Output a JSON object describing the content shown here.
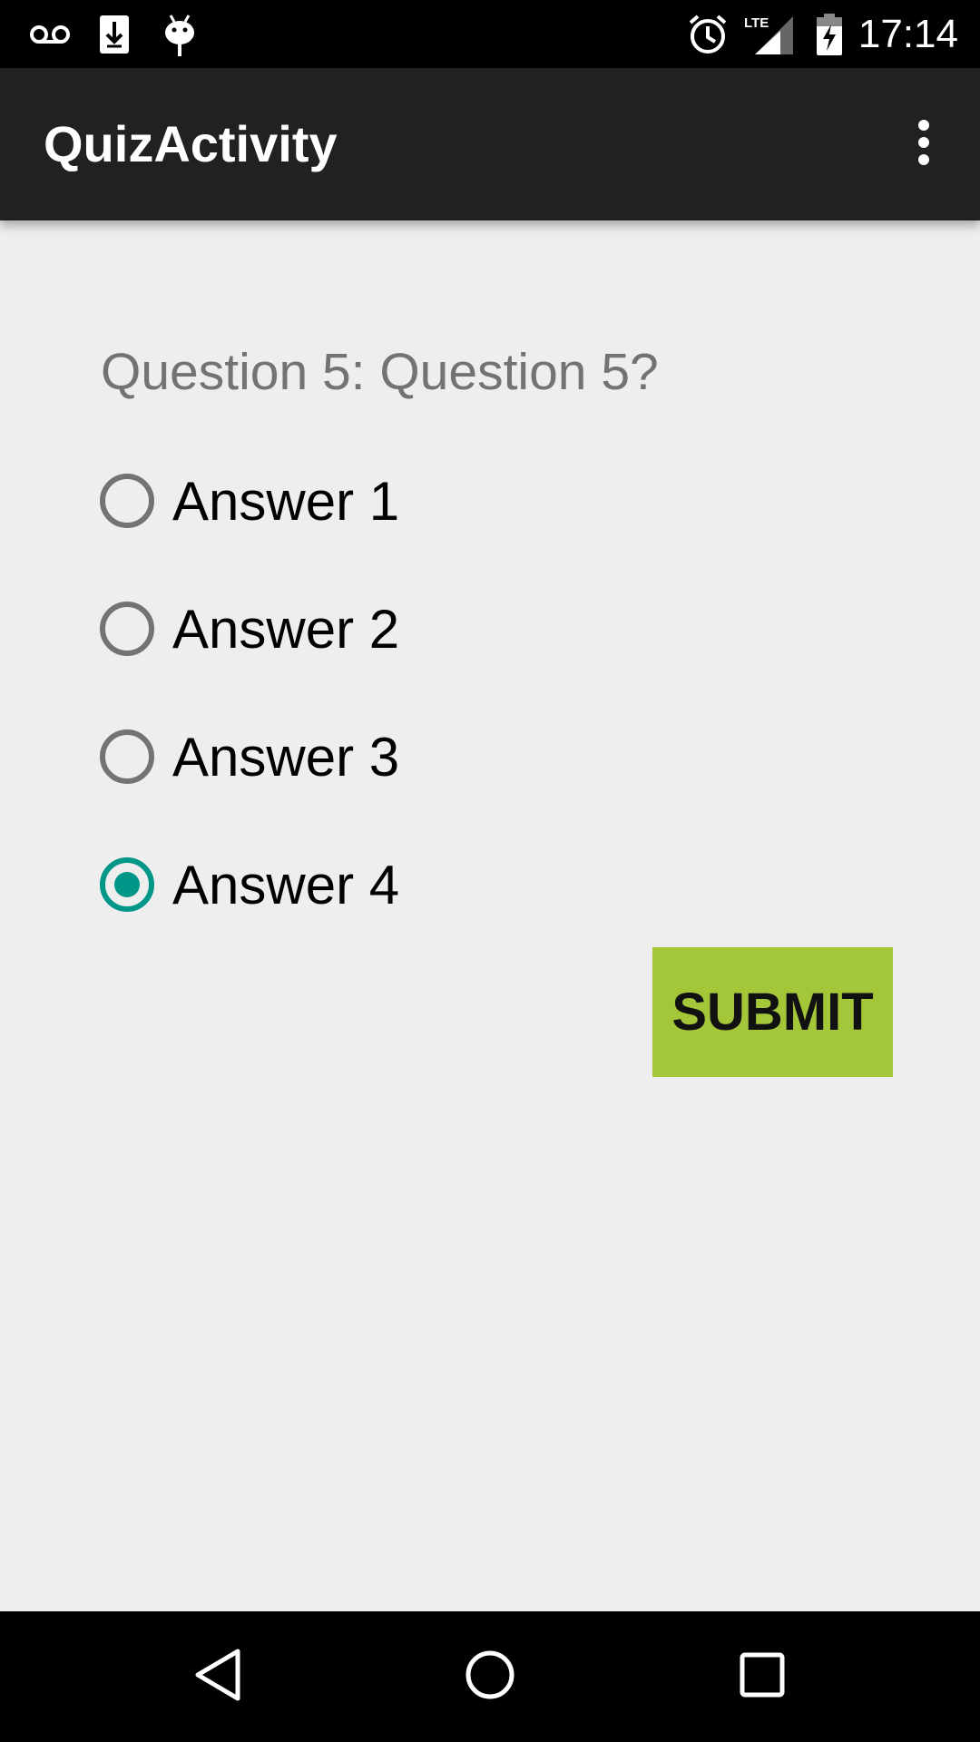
{
  "status_bar": {
    "time": "17:14",
    "icons": [
      "voicemail-icon",
      "download-icon",
      "android-debug-icon",
      "alarm-icon",
      "lte-signal-icon",
      "battery-charging-icon"
    ],
    "network_label": "LTE"
  },
  "app_bar": {
    "title": "QuizActivity",
    "menu_icon": "overflow-menu-icon"
  },
  "quiz": {
    "question": "Question 5: Question 5?",
    "answers": [
      {
        "label": "Answer 1",
        "selected": false
      },
      {
        "label": "Answer 2",
        "selected": false
      },
      {
        "label": "Answer 3",
        "selected": false
      },
      {
        "label": "Answer 4",
        "selected": true
      }
    ],
    "submit_label": "SUBMIT"
  },
  "colors": {
    "accent": "#009688",
    "submit_button": "#a4c639",
    "app_bar": "#212121",
    "background": "#eeeeee"
  },
  "nav_bar": {
    "icons": [
      "back-icon",
      "home-icon",
      "recents-icon"
    ]
  }
}
